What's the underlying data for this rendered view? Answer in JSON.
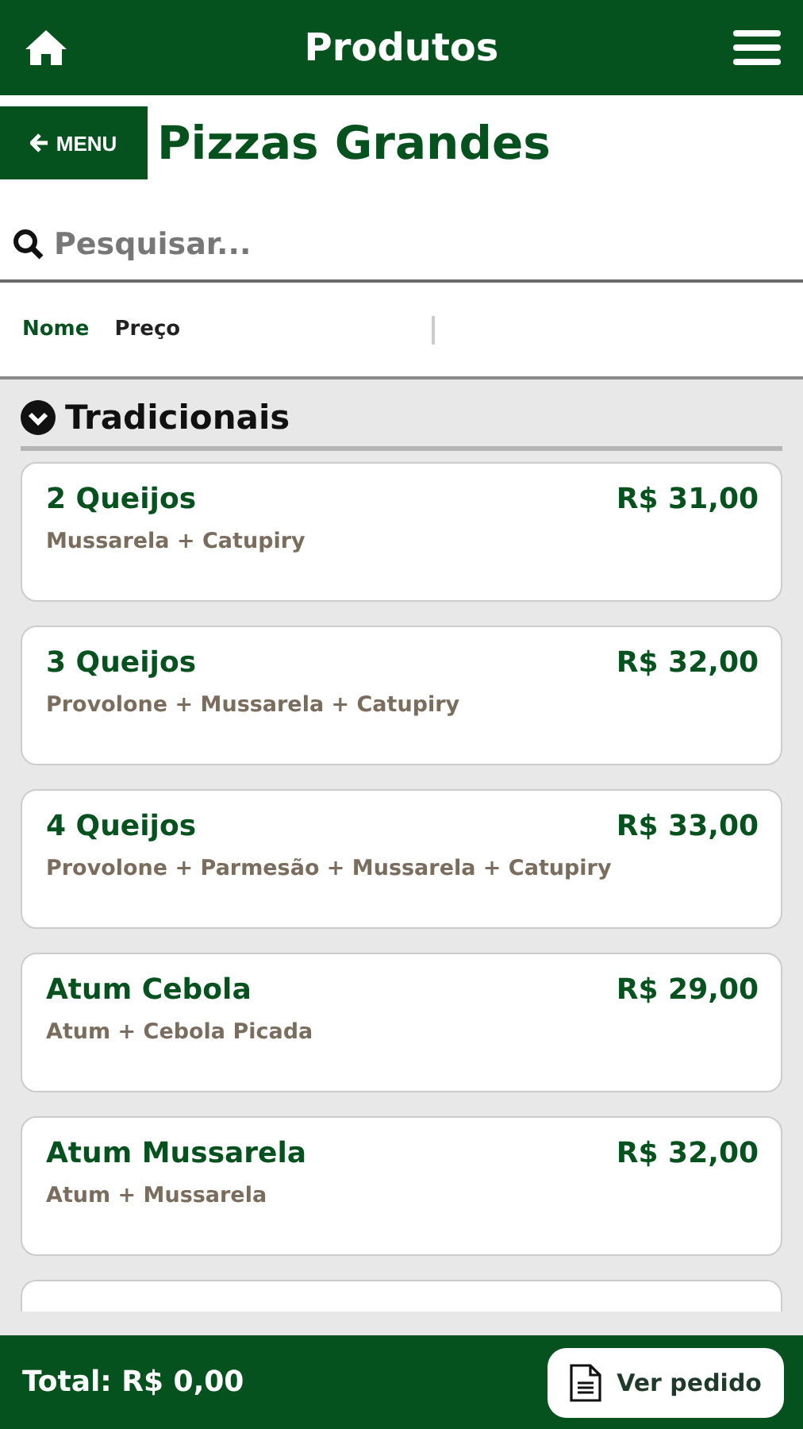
{
  "header": {
    "title": "Produtos"
  },
  "back_button": {
    "label": "MENU"
  },
  "page_title": "Pizzas Grandes",
  "search": {
    "placeholder": "Pesquisar..."
  },
  "sort_options": [
    {
      "label": "Nome",
      "selected": true
    },
    {
      "label": "Preço",
      "selected": false
    }
  ],
  "section": {
    "title": "Tradicionais",
    "expanded": true
  },
  "products": [
    {
      "name": "2 Queijos",
      "description": "Mussarela + Catupiry",
      "price": "R$ 31,00"
    },
    {
      "name": "3 Queijos",
      "description": "Provolone + Mussarela + Catupiry",
      "price": "R$ 32,00"
    },
    {
      "name": "4 Queijos",
      "description": "Provolone + Parmesão + Mussarela + Catupiry",
      "price": "R$ 33,00"
    },
    {
      "name": "Atum Cebola",
      "description": "Atum + Cebola Picada",
      "price": "R$ 29,00"
    },
    {
      "name": "Atum Mussarela",
      "description": "Atum + Mussarela",
      "price": "R$ 32,00"
    }
  ],
  "footer": {
    "total": "Total: R$ 0,00",
    "order_button": "Ver pedido"
  }
}
